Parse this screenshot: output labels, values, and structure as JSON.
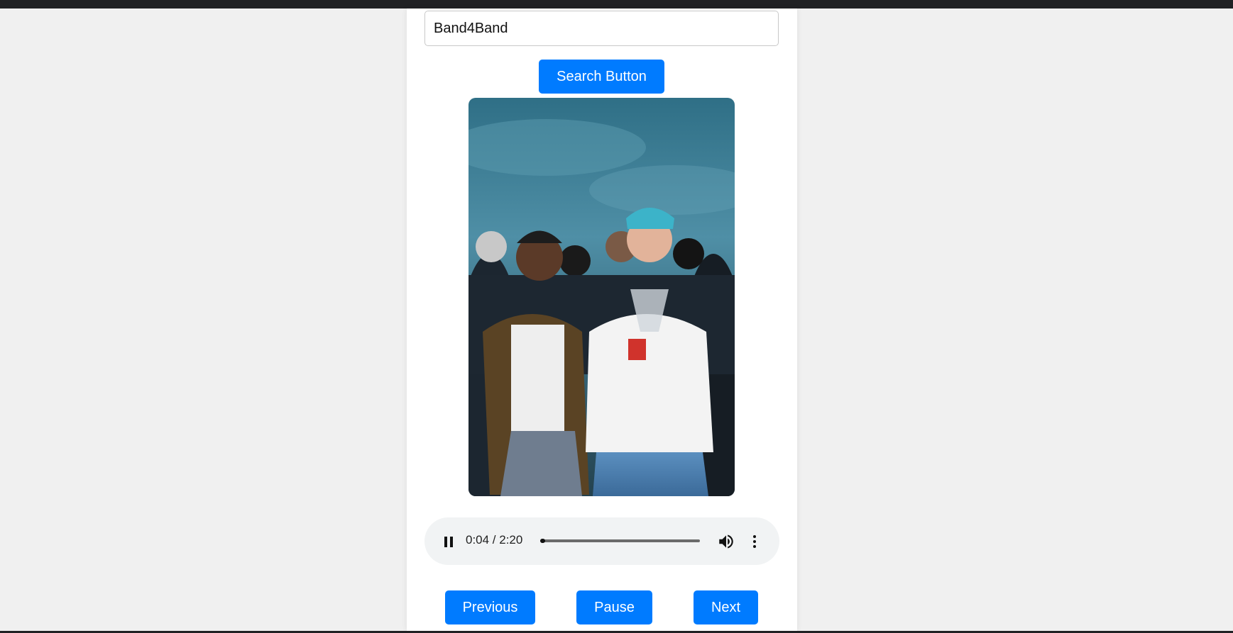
{
  "search": {
    "value": "Band4Band",
    "button_label": "Search Button"
  },
  "player": {
    "current_time": "0:04",
    "duration": "2:20",
    "time_display": "0:04 / 2:20",
    "progress_fraction": 0.03,
    "state": "playing"
  },
  "controls": {
    "previous_label": "Previous",
    "pause_label": "Pause",
    "next_label": "Next"
  },
  "colors": {
    "accent": "#007bff",
    "page_background": "#f0f0f0",
    "top_bar": "#202124",
    "audio_background": "#f1f3f4"
  },
  "icons": [
    "pause-icon",
    "volume-icon",
    "more-options-icon"
  ]
}
